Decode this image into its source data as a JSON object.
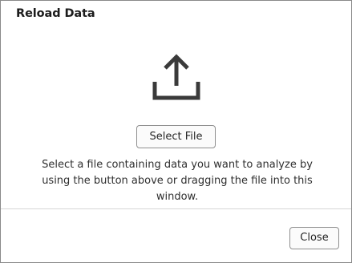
{
  "dialog": {
    "title": "Reload Data",
    "icon": "upload-icon",
    "select_button_label": "Select File",
    "instructions": "Select a file containing data you want to analyze by using the button above or dragging the file into this window.",
    "close_button_label": "Close"
  },
  "colors": {
    "icon": "#3a3a3a",
    "border": "#8a8a8a",
    "divider": "#d6d6d6"
  }
}
